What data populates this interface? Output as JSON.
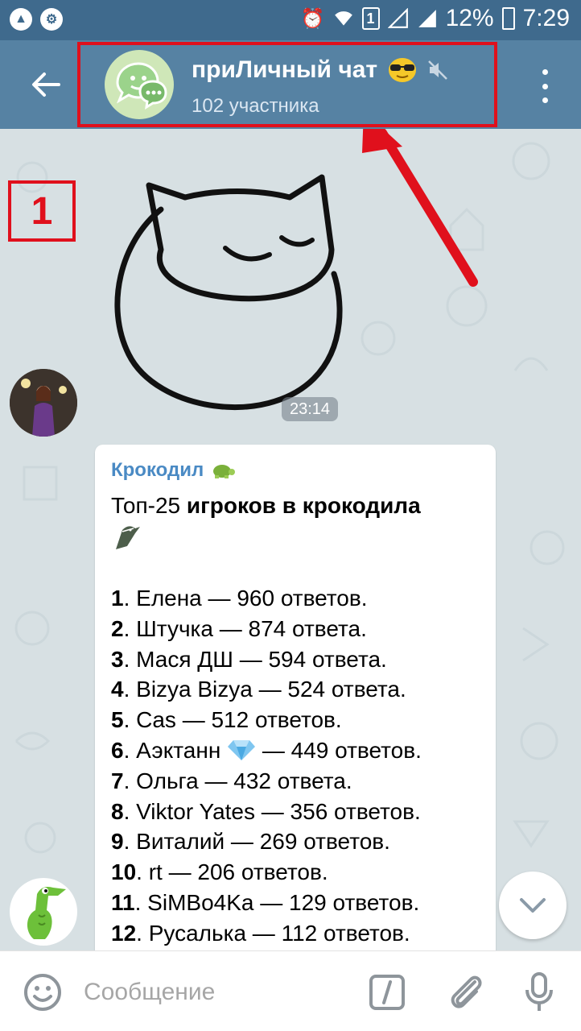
{
  "status_bar": {
    "battery_percent": "12%",
    "time": "7:29",
    "sim_label": "1",
    "left_icons": [
      "app-notification-icon",
      "settings-notification-icon"
    ],
    "right_icons": [
      "alarm-icon",
      "wifi-icon",
      "sim-icon",
      "signal-icon",
      "signal-icon",
      "battery-charging-icon"
    ]
  },
  "header": {
    "chat_title": "приЛичный чат",
    "title_emoji": "sunglasses-emoji",
    "muted": true,
    "members": "102 участника"
  },
  "annotation": {
    "marker_label": "1",
    "marker_color": "#e0101c"
  },
  "messages": {
    "sticker_time": "23:14",
    "post": {
      "sender": "Крокодил",
      "sender_emoji": "turtle-emoji",
      "heading_prefix": "Топ-25 ",
      "heading_bold": "игроков в крокодила",
      "heading_emoji": "crocodile-emoji",
      "rows": [
        {
          "num": "1",
          "text": ". Елена — 960 ответов."
        },
        {
          "num": "2",
          "text": ". Штучка — 874 ответа."
        },
        {
          "num": "3",
          "text": ". Мася ДШ — 594 ответа."
        },
        {
          "num": "4",
          "text": ". Bizya Bizya — 524 ответа."
        },
        {
          "num": "5",
          "text": ". Cas — 512 ответов."
        },
        {
          "num": "6",
          "text": ". Аэктанн",
          "text_after": " — 449 ответов.",
          "emoji": "diamond-emoji"
        },
        {
          "num": "7",
          "text": ". Ольга — 432 ответа."
        },
        {
          "num": "8",
          "text": ". Viktor Yates — 356 ответов."
        },
        {
          "num": "9",
          "text": ". Виталий — 269 ответов."
        },
        {
          "num": "10",
          "text": ". rt — 206 ответов."
        },
        {
          "num": "11",
          "text": ". SiMBo4Ka — 129 ответов."
        },
        {
          "num": "12",
          "text": ". Русалька — 112 ответов."
        }
      ]
    }
  },
  "input": {
    "placeholder": "Сообщение"
  },
  "colors": {
    "header": "#5682a3",
    "status_bar": "#3f6a8d",
    "chat_bg": "#d7e0e3",
    "sender_name": "#4a8ac4",
    "highlight": "#e0101c"
  }
}
